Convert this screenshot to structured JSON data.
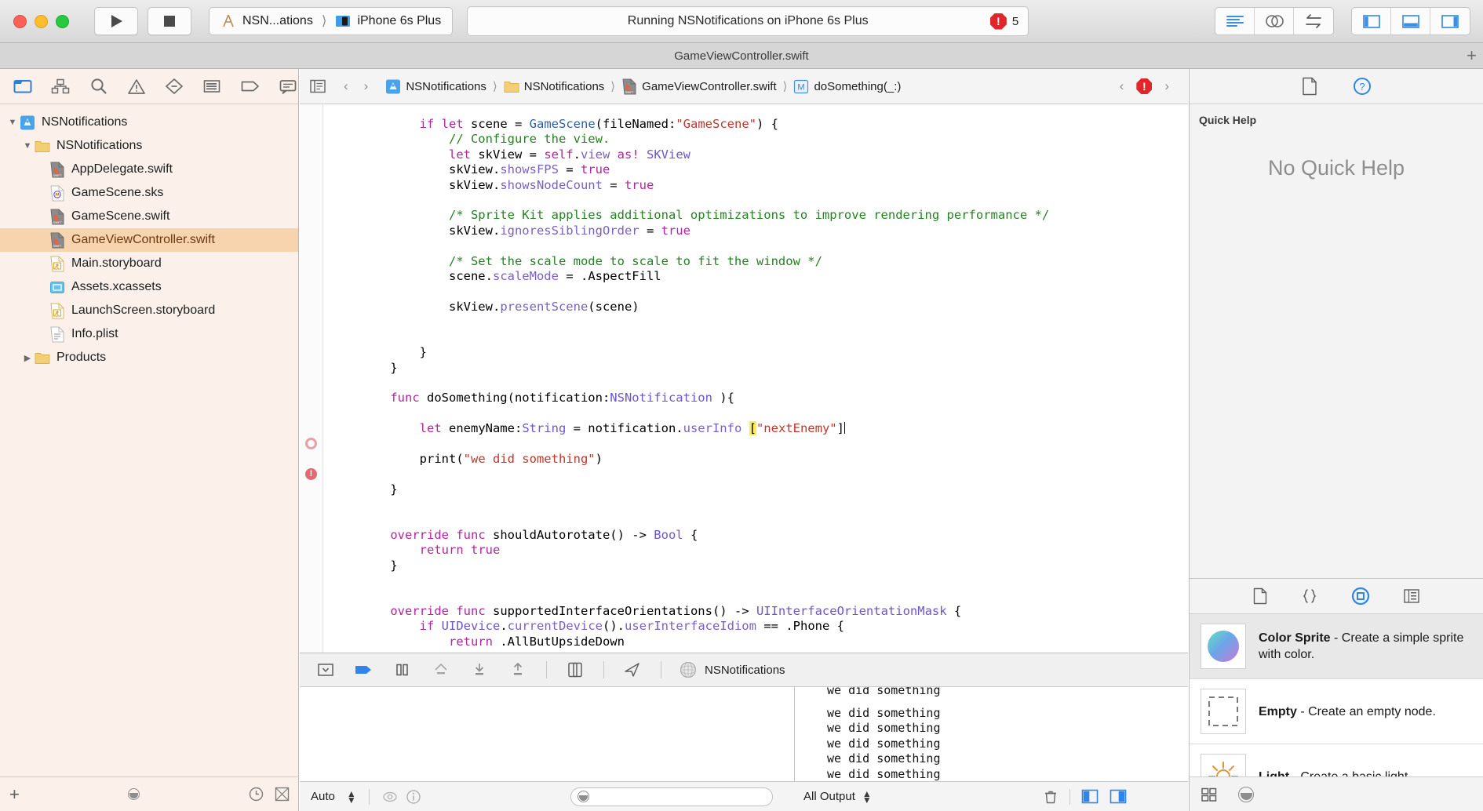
{
  "toolbar": {
    "run_icon": "play-icon",
    "stop_icon": "stop-icon",
    "scheme_name": "NSN...ations",
    "destination_name": "iPhone 6s Plus",
    "status_text": "Running NSNotifications on iPhone 6s Plus",
    "error_count": "5",
    "right_icons": [
      "standard-editor-icon",
      "assistant-editor-icon",
      "version-editor-icon"
    ],
    "panel_icons": [
      "toggle-navigator-icon",
      "toggle-debug-area-icon",
      "toggle-utilities-icon"
    ]
  },
  "tabbar": {
    "title": "GameViewController.swift",
    "add_label": "+"
  },
  "navigator": {
    "icons": [
      "folder-icon",
      "source-control-icon",
      "search-icon",
      "issue-icon",
      "test-icon",
      "debug-icon",
      "breakpoint-icon",
      "report-icon"
    ],
    "tree": [
      {
        "label": "NSNotifications",
        "depth": 0,
        "icon": "xcode-project-icon",
        "triangle": "▼",
        "selected": false
      },
      {
        "label": "NSNotifications",
        "depth": 1,
        "icon": "folder-yellow-icon",
        "triangle": "▼",
        "selected": false
      },
      {
        "label": "AppDelegate.swift",
        "depth": 2,
        "icon": "swift-file-icon",
        "triangle": "",
        "selected": false
      },
      {
        "label": "GameScene.sks",
        "depth": 2,
        "icon": "sks-file-icon",
        "triangle": "",
        "selected": false
      },
      {
        "label": "GameScene.swift",
        "depth": 2,
        "icon": "swift-file-icon",
        "triangle": "",
        "selected": false
      },
      {
        "label": "GameViewController.swift",
        "depth": 2,
        "icon": "swift-file-icon",
        "triangle": "",
        "selected": true
      },
      {
        "label": "Main.storyboard",
        "depth": 2,
        "icon": "storyboard-file-icon",
        "triangle": "",
        "selected": false
      },
      {
        "label": "Assets.xcassets",
        "depth": 2,
        "icon": "assets-icon",
        "triangle": "",
        "selected": false
      },
      {
        "label": "LaunchScreen.storyboard",
        "depth": 2,
        "icon": "storyboard-file-icon",
        "triangle": "",
        "selected": false
      },
      {
        "label": "Info.plist",
        "depth": 2,
        "icon": "plist-file-icon",
        "triangle": "",
        "selected": false
      },
      {
        "label": "Products",
        "depth": 1,
        "icon": "folder-yellow-icon",
        "triangle": "▶",
        "selected": false
      }
    ],
    "bottom": {
      "add_label": "+",
      "filter_icon": "filter-circle-icon",
      "recent_icon": "recent-icon",
      "unsaved_icon": "unsaved-icon"
    }
  },
  "editor": {
    "jumpbar": {
      "related_icon": "related-files-icon",
      "back_arrow": "‹",
      "forward_arrow": "›",
      "crumbs": [
        {
          "label": "NSNotifications",
          "icon": "xcode-project-icon"
        },
        {
          "label": "NSNotifications",
          "icon": "folder-yellow-icon"
        },
        {
          "label": "GameViewController.swift",
          "icon": "swift-file-icon"
        },
        {
          "label": "doSomething(_:)",
          "icon": "method-badge-icon"
        }
      ],
      "prev_issue": "‹",
      "issue_icon": "error-icon",
      "next_issue": "›"
    },
    "code_lines": [
      {
        "indent": 0,
        "tokens": [
          {
            "t": "",
            "v": "        "
          },
          {
            "t": "k",
            "v": "if"
          },
          {
            "t": "",
            "v": " "
          },
          {
            "t": "k",
            "v": "let"
          },
          {
            "t": "",
            "v": " scene = "
          },
          {
            "t": "p",
            "v": "GameScene"
          },
          {
            "t": "",
            "v": "(fileNamed:"
          },
          {
            "t": "s",
            "v": "\"GameScene\""
          },
          {
            "t": "",
            "v": ") {"
          }
        ]
      },
      {
        "indent": 0,
        "tokens": [
          {
            "t": "",
            "v": "            "
          },
          {
            "t": "c",
            "v": "// Configure the view."
          }
        ]
      },
      {
        "indent": 0,
        "tokens": [
          {
            "t": "",
            "v": "            "
          },
          {
            "t": "k",
            "v": "let"
          },
          {
            "t": "",
            "v": " skView = "
          },
          {
            "t": "k",
            "v": "self"
          },
          {
            "t": "",
            "v": "."
          },
          {
            "t": "m",
            "v": "view"
          },
          {
            "t": "",
            "v": " "
          },
          {
            "t": "k",
            "v": "as!"
          },
          {
            "t": "",
            "v": " "
          },
          {
            "t": "t",
            "v": "SKView"
          }
        ]
      },
      {
        "indent": 0,
        "tokens": [
          {
            "t": "",
            "v": "            skView."
          },
          {
            "t": "m",
            "v": "showsFPS"
          },
          {
            "t": "",
            "v": " = "
          },
          {
            "t": "k",
            "v": "true"
          }
        ]
      },
      {
        "indent": 0,
        "tokens": [
          {
            "t": "",
            "v": "            skView."
          },
          {
            "t": "m",
            "v": "showsNodeCount"
          },
          {
            "t": "",
            "v": " = "
          },
          {
            "t": "k",
            "v": "true"
          }
        ]
      },
      {
        "indent": 0,
        "tokens": []
      },
      {
        "indent": 0,
        "tokens": [
          {
            "t": "",
            "v": "            "
          },
          {
            "t": "c",
            "v": "/* Sprite Kit applies additional optimizations to improve rendering performance */"
          }
        ]
      },
      {
        "indent": 0,
        "tokens": [
          {
            "t": "",
            "v": "            skView."
          },
          {
            "t": "m",
            "v": "ignoresSiblingOrder"
          },
          {
            "t": "",
            "v": " = "
          },
          {
            "t": "k",
            "v": "true"
          }
        ]
      },
      {
        "indent": 0,
        "tokens": []
      },
      {
        "indent": 0,
        "tokens": [
          {
            "t": "",
            "v": "            "
          },
          {
            "t": "c",
            "v": "/* Set the scale mode to scale to fit the window */"
          }
        ]
      },
      {
        "indent": 0,
        "tokens": [
          {
            "t": "",
            "v": "            scene."
          },
          {
            "t": "m",
            "v": "scaleMode"
          },
          {
            "t": "",
            "v": " = ."
          },
          {
            "t": "",
            "v": "AspectFill"
          }
        ]
      },
      {
        "indent": 0,
        "tokens": []
      },
      {
        "indent": 0,
        "tokens": [
          {
            "t": "",
            "v": "            skView."
          },
          {
            "t": "m",
            "v": "presentScene"
          },
          {
            "t": "",
            "v": "(scene)"
          }
        ]
      },
      {
        "indent": 0,
        "tokens": []
      },
      {
        "indent": 0,
        "tokens": []
      },
      {
        "indent": 0,
        "tokens": [
          {
            "t": "",
            "v": "        }"
          }
        ]
      },
      {
        "indent": 0,
        "tokens": [
          {
            "t": "",
            "v": "    }"
          }
        ]
      },
      {
        "indent": 0,
        "tokens": []
      },
      {
        "indent": 0,
        "tokens": [
          {
            "t": "",
            "v": "    "
          },
          {
            "t": "k",
            "v": "func"
          },
          {
            "t": "",
            "v": " doSomething(notification:"
          },
          {
            "t": "t",
            "v": "NSNotification"
          },
          {
            "t": "",
            "v": " ){"
          }
        ]
      },
      {
        "indent": 0,
        "tokens": []
      },
      {
        "indent": 0,
        "tokens": [
          {
            "t": "",
            "v": "        "
          },
          {
            "t": "k",
            "v": "let"
          },
          {
            "t": "",
            "v": " enemyName:"
          },
          {
            "t": "t",
            "v": "String"
          },
          {
            "t": "",
            "v": " = notification."
          },
          {
            "t": "m",
            "v": "userInfo"
          },
          {
            "t": "",
            "v": " "
          },
          {
            "t": "hl",
            "v": "["
          },
          {
            "t": "s",
            "v": "\"nextEnemy\""
          },
          {
            "t": "",
            "v": "]"
          },
          {
            "t": "caret",
            "v": ""
          }
        ]
      },
      {
        "indent": 0,
        "tokens": []
      },
      {
        "indent": 0,
        "tokens": [
          {
            "t": "",
            "v": "        "
          },
          {
            "t": "",
            "v": "print("
          },
          {
            "t": "s",
            "v": "\"we did something\""
          },
          {
            "t": "",
            "v": ")"
          }
        ]
      },
      {
        "indent": 0,
        "tokens": []
      },
      {
        "indent": 0,
        "tokens": [
          {
            "t": "",
            "v": "    }"
          }
        ]
      },
      {
        "indent": 0,
        "tokens": []
      },
      {
        "indent": 0,
        "tokens": []
      },
      {
        "indent": 0,
        "tokens": [
          {
            "t": "",
            "v": "    "
          },
          {
            "t": "k",
            "v": "override"
          },
          {
            "t": "",
            "v": " "
          },
          {
            "t": "k",
            "v": "func"
          },
          {
            "t": "",
            "v": " shouldAutorotate() -> "
          },
          {
            "t": "t",
            "v": "Bool"
          },
          {
            "t": "",
            "v": " {"
          }
        ]
      },
      {
        "indent": 0,
        "tokens": [
          {
            "t": "",
            "v": "        "
          },
          {
            "t": "k",
            "v": "return"
          },
          {
            "t": "",
            "v": " "
          },
          {
            "t": "k",
            "v": "true"
          }
        ]
      },
      {
        "indent": 0,
        "tokens": [
          {
            "t": "",
            "v": "    }"
          }
        ]
      },
      {
        "indent": 0,
        "tokens": []
      },
      {
        "indent": 0,
        "tokens": []
      },
      {
        "indent": 0,
        "tokens": [
          {
            "t": "",
            "v": "    "
          },
          {
            "t": "k",
            "v": "override"
          },
          {
            "t": "",
            "v": " "
          },
          {
            "t": "k",
            "v": "func"
          },
          {
            "t": "",
            "v": " supportedInterfaceOrientations() -> "
          },
          {
            "t": "t",
            "v": "UIInterfaceOrientationMask"
          },
          {
            "t": "",
            "v": " {"
          }
        ]
      },
      {
        "indent": 0,
        "tokens": [
          {
            "t": "",
            "v": "        "
          },
          {
            "t": "k",
            "v": "if"
          },
          {
            "t": "",
            "v": " "
          },
          {
            "t": "t",
            "v": "UIDevice"
          },
          {
            "t": "",
            "v": "."
          },
          {
            "t": "m",
            "v": "currentDevice"
          },
          {
            "t": "",
            "v": "()."
          },
          {
            "t": "m",
            "v": "userInterfaceIdiom"
          },
          {
            "t": "",
            "v": " == ."
          },
          {
            "t": "",
            "v": "Phone {"
          }
        ]
      },
      {
        "indent": 0,
        "tokens": [
          {
            "t": "",
            "v": "            "
          },
          {
            "t": "k",
            "v": "return"
          },
          {
            "t": "",
            "v": " .AllButUpsideDown"
          }
        ]
      }
    ],
    "breakpoint_line": 22,
    "error_line": 24
  },
  "debugbar": {
    "icons": [
      "hide-debug-area-icon",
      "continue-icon",
      "pause-icon",
      "step-over-icon",
      "step-into-icon",
      "step-out-icon",
      "view-hierarchy-icon",
      "location-icon"
    ],
    "process_icon": "process-icon",
    "process_name": "NSNotifications"
  },
  "console": {
    "lines": [
      "we did something",
      "we did something",
      "we did something",
      "we did something",
      "we did something",
      "we did something",
      "we did something"
    ]
  },
  "debug_status": {
    "scope_label": "Auto",
    "eye_icon": "eye-icon",
    "info_icon": "info-icon",
    "variables_filter_placeholder": "",
    "output_label": "All Output",
    "trash_icon": "trash-icon",
    "split_icons": [
      "show-variables-icon",
      "show-console-icon"
    ]
  },
  "utility": {
    "tabs": [
      "file-inspector-icon",
      "quick-help-inspector-icon"
    ],
    "quick_help": {
      "title": "Quick Help",
      "empty_text": "No Quick Help"
    },
    "library_tabs": [
      "file-template-library-icon",
      "code-snippet-library-icon",
      "object-library-icon",
      "media-library-icon"
    ],
    "library_items": [
      {
        "title": "Color Sprite",
        "desc": " - Create a simple sprite with color.",
        "thumb": "color-sprite-thumb",
        "selected": true
      },
      {
        "title": "Empty",
        "desc": " - Create an empty node.",
        "thumb": "empty-node-thumb",
        "selected": false
      },
      {
        "title": "Light",
        "desc": " - Create a basic light.",
        "thumb": "light-node-thumb",
        "selected": false
      }
    ],
    "bottom": {
      "grid_icon": "grid-view-icon",
      "filter_icon": "filter-circle-icon"
    }
  }
}
